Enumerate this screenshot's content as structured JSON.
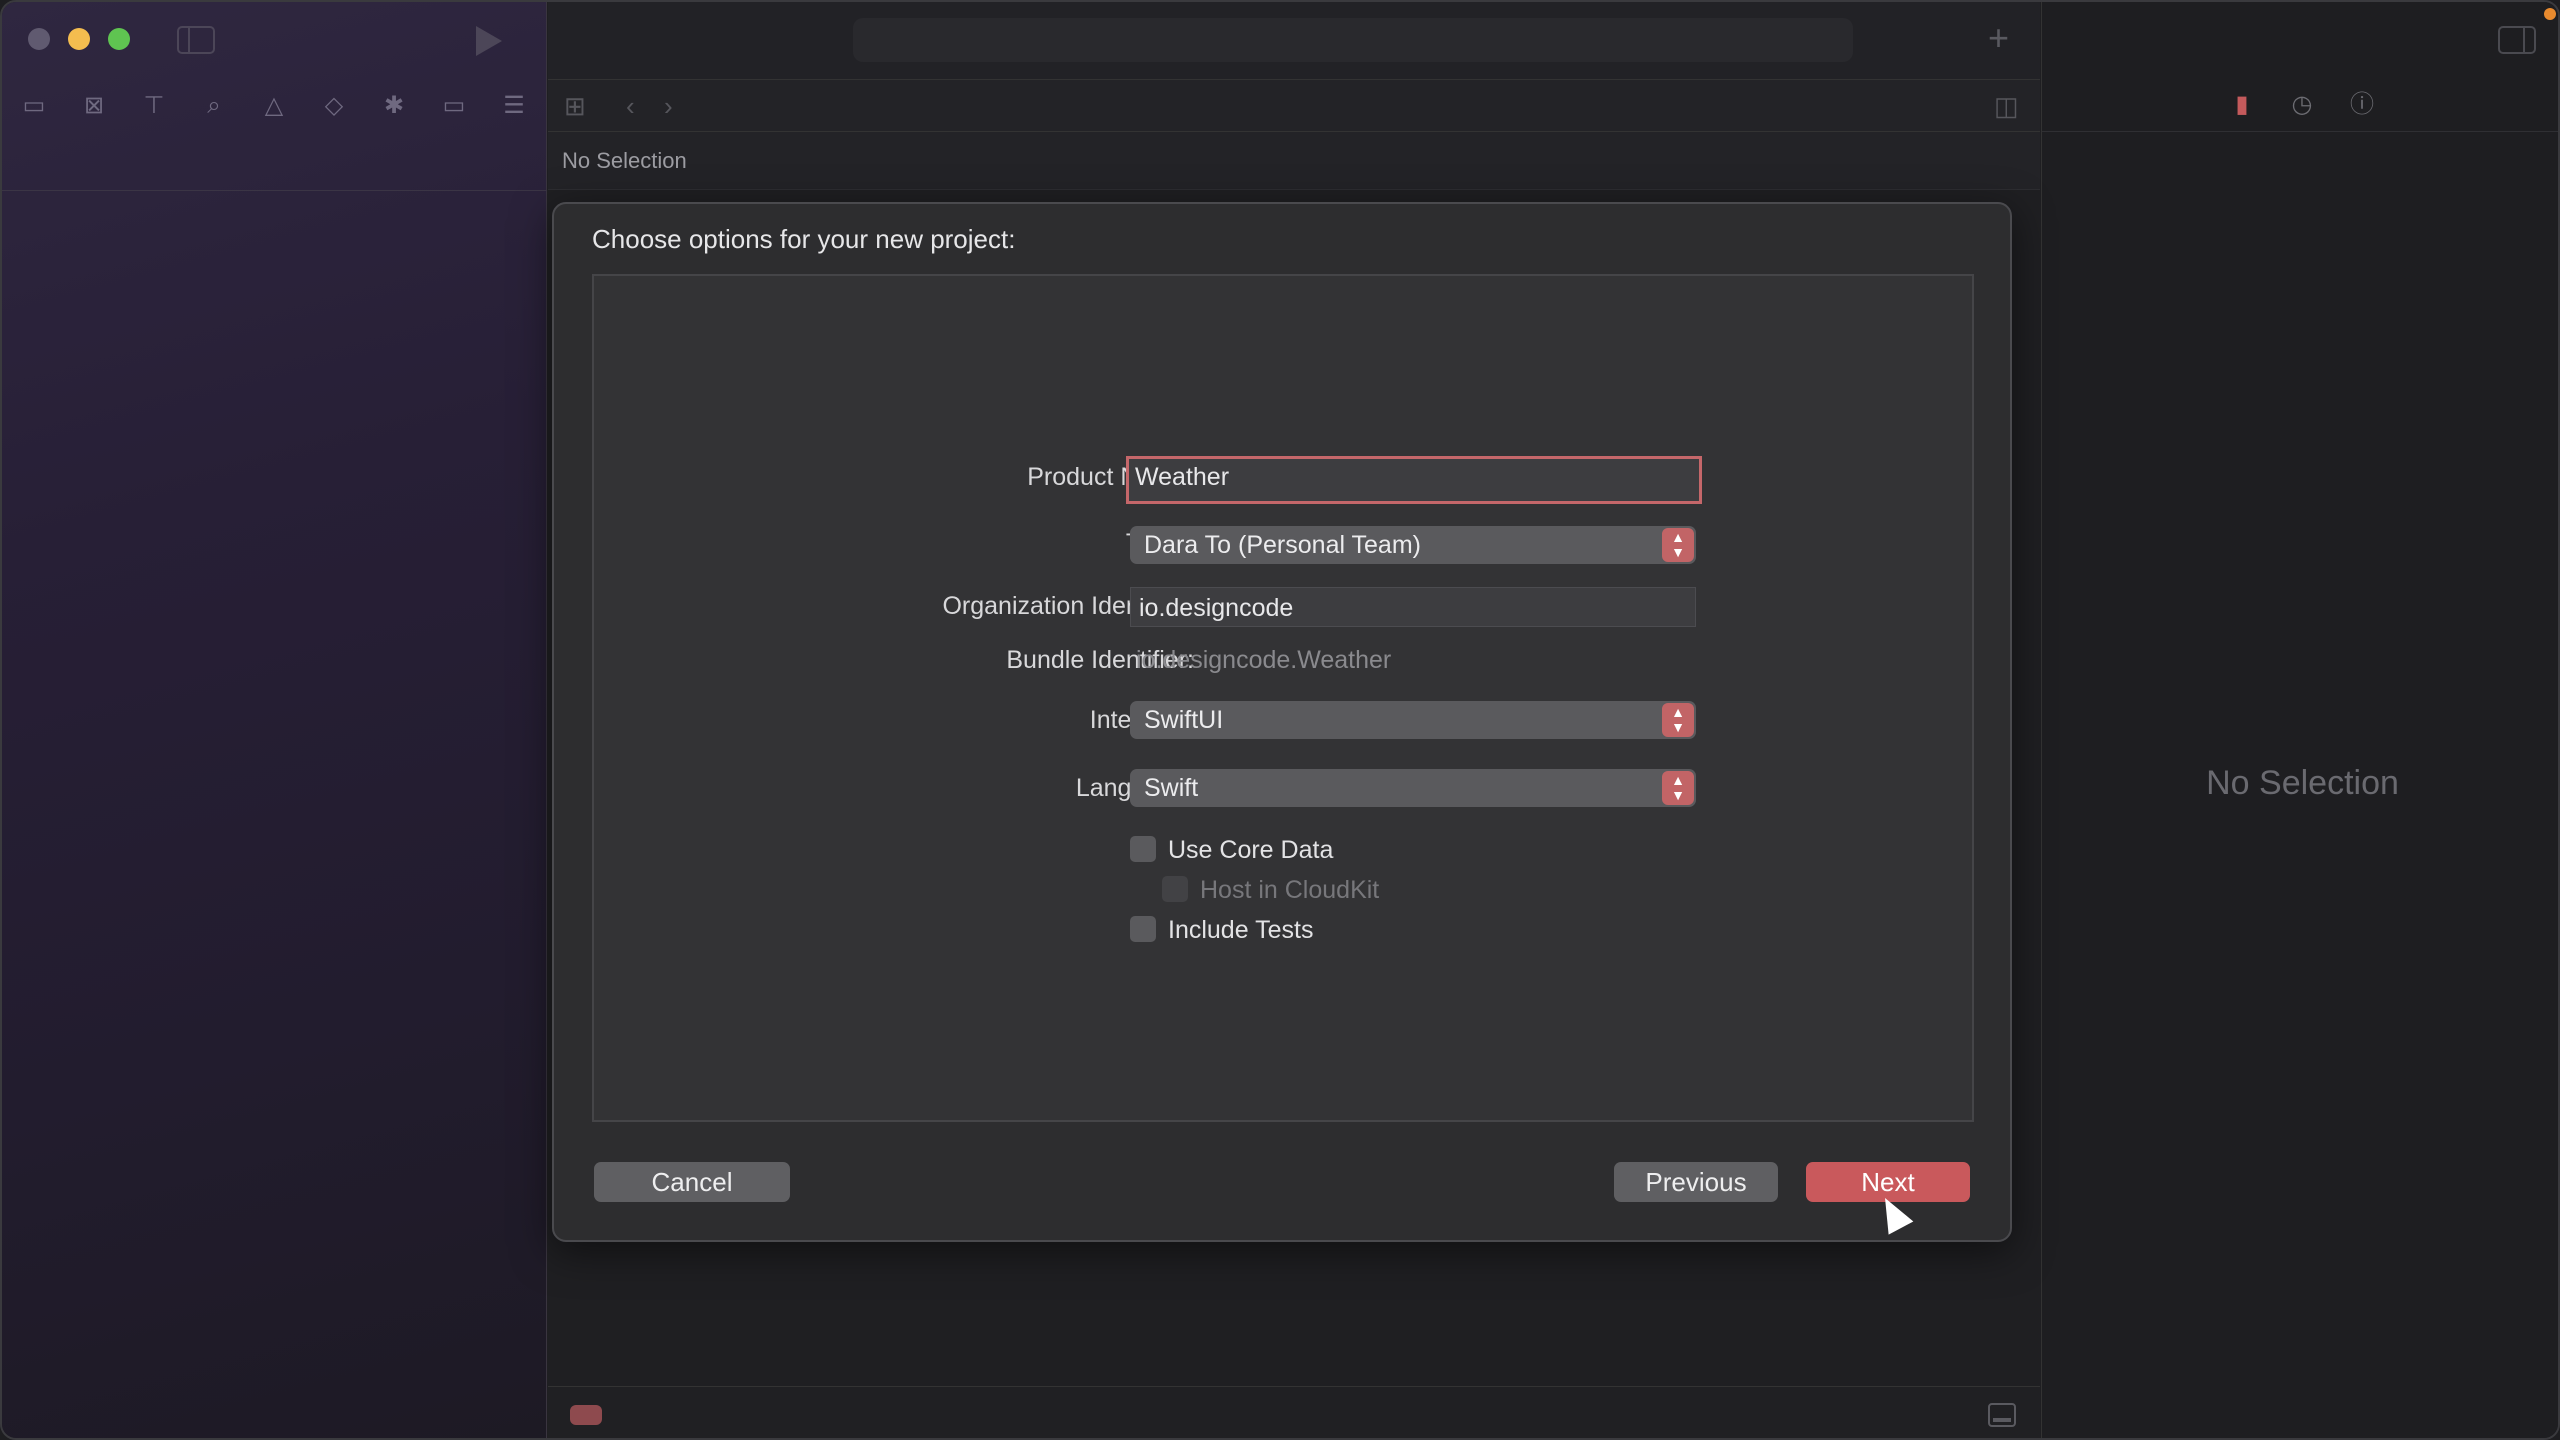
{
  "editor": {
    "path_label": "No Selection"
  },
  "inspector": {
    "empty_label": "No Selection"
  },
  "sheet": {
    "title": "Choose options for your new project:",
    "fields": {
      "product_name_label": "Product Name:",
      "product_name_value": "Weather",
      "team_label": "Team:",
      "team_value": "Dara To (Personal Team)",
      "org_id_label": "Organization Identifier:",
      "org_id_value": "io.designcode",
      "bundle_id_label": "Bundle Identifier:",
      "bundle_id_value": "io.designcode.Weather",
      "interface_label": "Interface:",
      "interface_value": "SwiftUI",
      "language_label": "Language:",
      "language_value": "Swift"
    },
    "checkboxes": {
      "core_data": {
        "label": "Use Core Data",
        "checked": false
      },
      "cloudkit": {
        "label": "Host in CloudKit",
        "checked": false,
        "enabled": false
      },
      "tests": {
        "label": "Include Tests",
        "checked": false
      }
    },
    "buttons": {
      "cancel": "Cancel",
      "previous": "Previous",
      "next": "Next"
    }
  },
  "colors": {
    "accent": "#c9595c",
    "focus_ring": "#c5676a"
  }
}
